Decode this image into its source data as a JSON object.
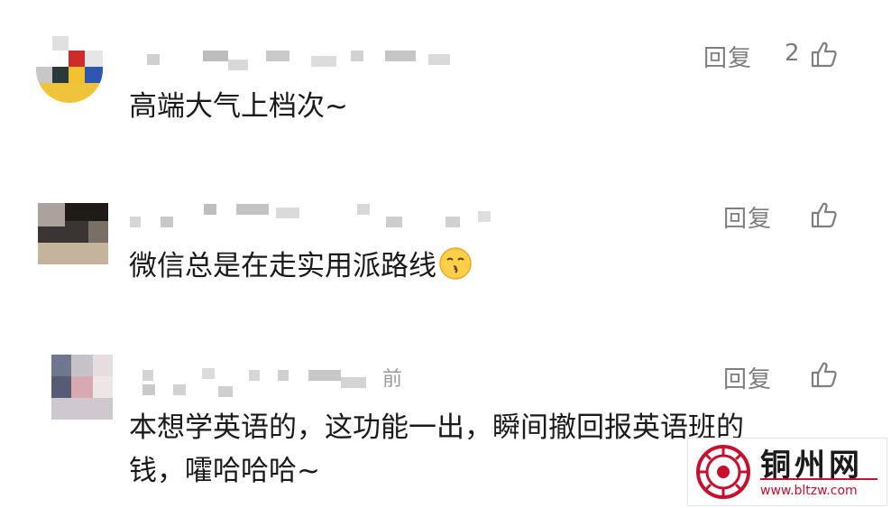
{
  "comments": [
    {
      "text": "高端大气上档次~",
      "reply_label": "回复",
      "like_count": "2",
      "time_suffix": ""
    },
    {
      "text": "微信总是在走实用派路线",
      "reply_label": "回复",
      "like_count": "",
      "time_suffix": "",
      "emoji": "kissing-face"
    },
    {
      "text_line1": "本想学英语的，这功能一出，瞬间撤回报英语班的",
      "text_line2": "钱，嚯哈哈哈~",
      "reply_label": "回复",
      "like_count": "",
      "time_suffix": "前"
    }
  ],
  "watermark": {
    "title": "铜州网",
    "url": "www.bltzw.com",
    "brand_color": "#c8102e"
  },
  "colors": {
    "text": "#1a1a1a",
    "meta": "#7e7e7e",
    "blur": "#d4d4d4"
  }
}
